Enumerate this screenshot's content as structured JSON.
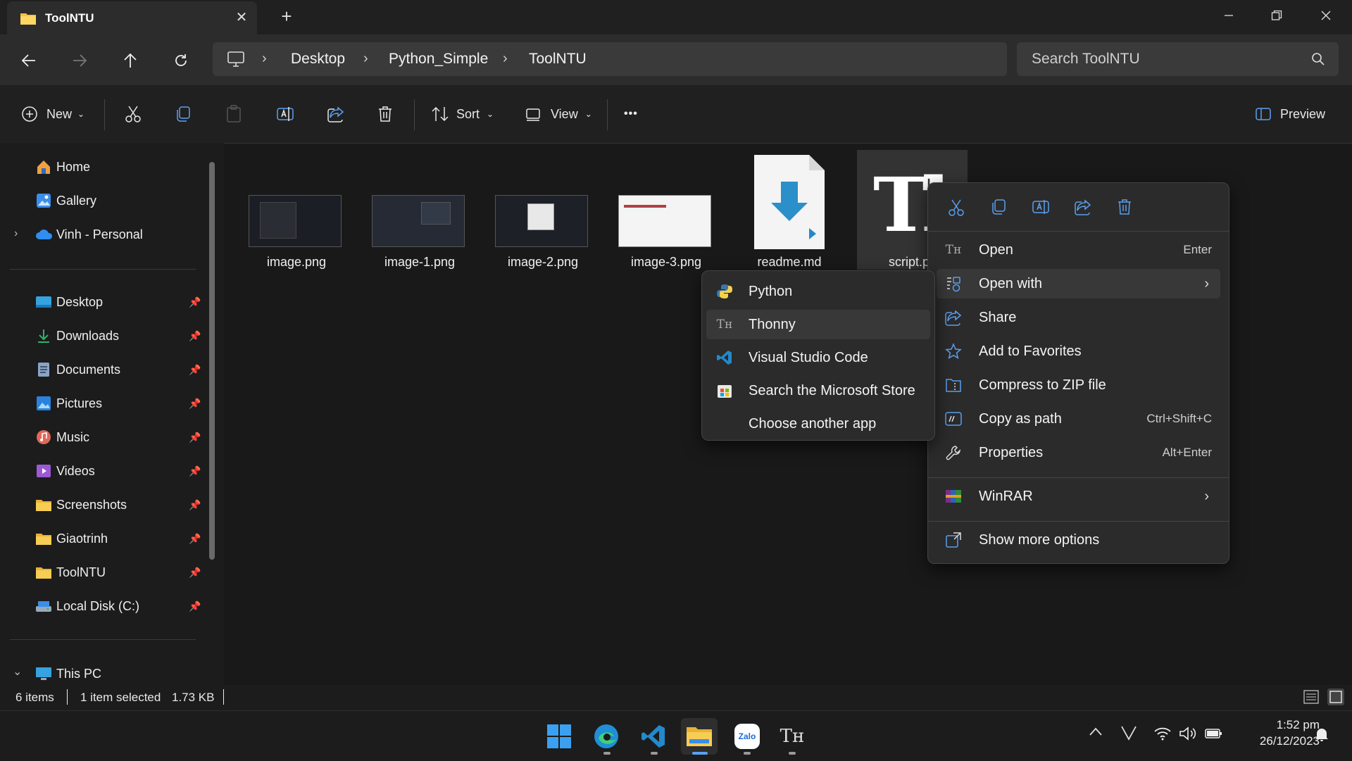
{
  "window": {
    "tab_title": "ToolNTU",
    "tab_close": "✕",
    "new_tab": "+"
  },
  "breadcrumb": [
    "Desktop",
    "Python_Simple",
    "ToolNTU"
  ],
  "search": {
    "placeholder": "Search ToolNTU"
  },
  "command_bar": {
    "new_label": "New",
    "sort_label": "Sort",
    "view_label": "View",
    "more_label": "•••",
    "preview_label": "Preview"
  },
  "nav": {
    "top": [
      {
        "label": "Home",
        "icon": "home-icon"
      },
      {
        "label": "Gallery",
        "icon": "gallery-icon"
      },
      {
        "label": "Vinh - Personal",
        "icon": "onedrive-icon"
      }
    ],
    "pinned": [
      {
        "label": "Desktop",
        "icon": "desktop-folder-icon"
      },
      {
        "label": "Downloads",
        "icon": "downloads-icon"
      },
      {
        "label": "Documents",
        "icon": "documents-icon"
      },
      {
        "label": "Pictures",
        "icon": "pictures-icon"
      },
      {
        "label": "Music",
        "icon": "music-icon"
      },
      {
        "label": "Videos",
        "icon": "videos-icon"
      },
      {
        "label": "Screenshots",
        "icon": "folder-icon"
      },
      {
        "label": "Giaotrinh",
        "icon": "folder-icon"
      },
      {
        "label": "ToolNTU",
        "icon": "folder-icon"
      },
      {
        "label": "Local Disk (C:)",
        "icon": "drive-icon"
      }
    ],
    "this_pc": "This PC"
  },
  "files": [
    {
      "name": "image.png"
    },
    {
      "name": "image-1.png"
    },
    {
      "name": "image-2.png"
    },
    {
      "name": "image-3.png"
    },
    {
      "name": "readme.md"
    },
    {
      "name": "script.p"
    }
  ],
  "status": {
    "count": "6 items",
    "selection": "1 item selected",
    "size": "1.73 KB"
  },
  "context_menu": {
    "items": [
      {
        "label": "Open",
        "shortcut": "Enter",
        "icon": "thonny-icon"
      },
      {
        "label": "Open with",
        "shortcut": "",
        "icon": "open-with-icon"
      },
      {
        "label": "Share",
        "shortcut": "",
        "icon": "share-icon"
      },
      {
        "label": "Add to Favorites",
        "shortcut": "",
        "icon": "star-icon"
      },
      {
        "label": "Compress to ZIP file",
        "shortcut": "",
        "icon": "zip-icon"
      },
      {
        "label": "Copy as path",
        "shortcut": "Ctrl+Shift+C",
        "icon": "copy-path-icon"
      },
      {
        "label": "Properties",
        "shortcut": "Alt+Enter",
        "icon": "wrench-icon"
      }
    ],
    "winrar": "WinRAR",
    "more_options": "Show more options"
  },
  "open_with_menu": {
    "items": [
      {
        "label": "Python",
        "icon": "python-icon"
      },
      {
        "label": "Thonny",
        "icon": "thonny-icon"
      },
      {
        "label": "Visual Studio Code",
        "icon": "vscode-icon"
      },
      {
        "label": "Search the Microsoft Store",
        "icon": "store-icon"
      },
      {
        "label": "Choose another app",
        "icon": ""
      }
    ]
  },
  "taskbar": {
    "clock_time": "1:52 pm",
    "clock_date": "26/12/2023",
    "zalo_label": "Zalo"
  },
  "colors": {
    "accent": "#0078d4",
    "folder_yellow": "#f5c342",
    "vscode_blue": "#2489ca"
  }
}
